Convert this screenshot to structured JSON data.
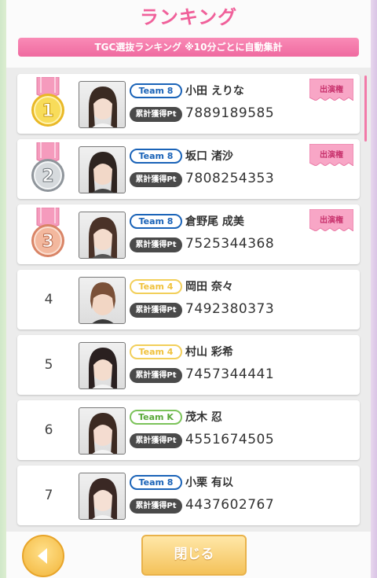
{
  "header": {
    "title": "ランキング",
    "banner": "TGC選抜ランキング ※10分ごとに自動集計"
  },
  "colors": {
    "accent_pink": "#f0609a",
    "team8_blue": "#1a63b8",
    "team4_yellow": "#f2cf5a",
    "teamk_green": "#7cc35a",
    "gold": "#f2c53d",
    "silver": "#bfc3c8",
    "bronze": "#e9a98a"
  },
  "ranking": [
    {
      "rank": "1",
      "medal": "gold-medal-icon",
      "team": "Team 8",
      "name": "小田 えりな",
      "pt_label": "累計獲得Pt",
      "points": "7889189585",
      "appearance": "出演権"
    },
    {
      "rank": "2",
      "medal": "silver-medal-icon",
      "team": "Team 8",
      "name": "坂口 渚沙",
      "pt_label": "累計獲得Pt",
      "points": "7808254353",
      "appearance": "出演権"
    },
    {
      "rank": "3",
      "medal": "bronze-medal-icon",
      "team": "Team 8",
      "name": "倉野尾 成美",
      "pt_label": "累計獲得Pt",
      "points": "7525344368",
      "appearance": "出演権"
    },
    {
      "rank": "4",
      "team": "Team 4",
      "name": "岡田 奈々",
      "pt_label": "累計獲得Pt",
      "points": "7492380373"
    },
    {
      "rank": "5",
      "team": "Team 4",
      "name": "村山 彩希",
      "pt_label": "累計獲得Pt",
      "points": "7457344441"
    },
    {
      "rank": "6",
      "team": "Team K",
      "name": "茂木 忍",
      "pt_label": "累計獲得Pt",
      "points": "4551674505"
    },
    {
      "rank": "7",
      "team": "Team 8",
      "name": "小栗 有以",
      "pt_label": "累計獲得Pt",
      "points": "4437602767"
    }
  ],
  "footer": {
    "close_label": "閉じる",
    "back_icon": "back-arrow-icon"
  }
}
